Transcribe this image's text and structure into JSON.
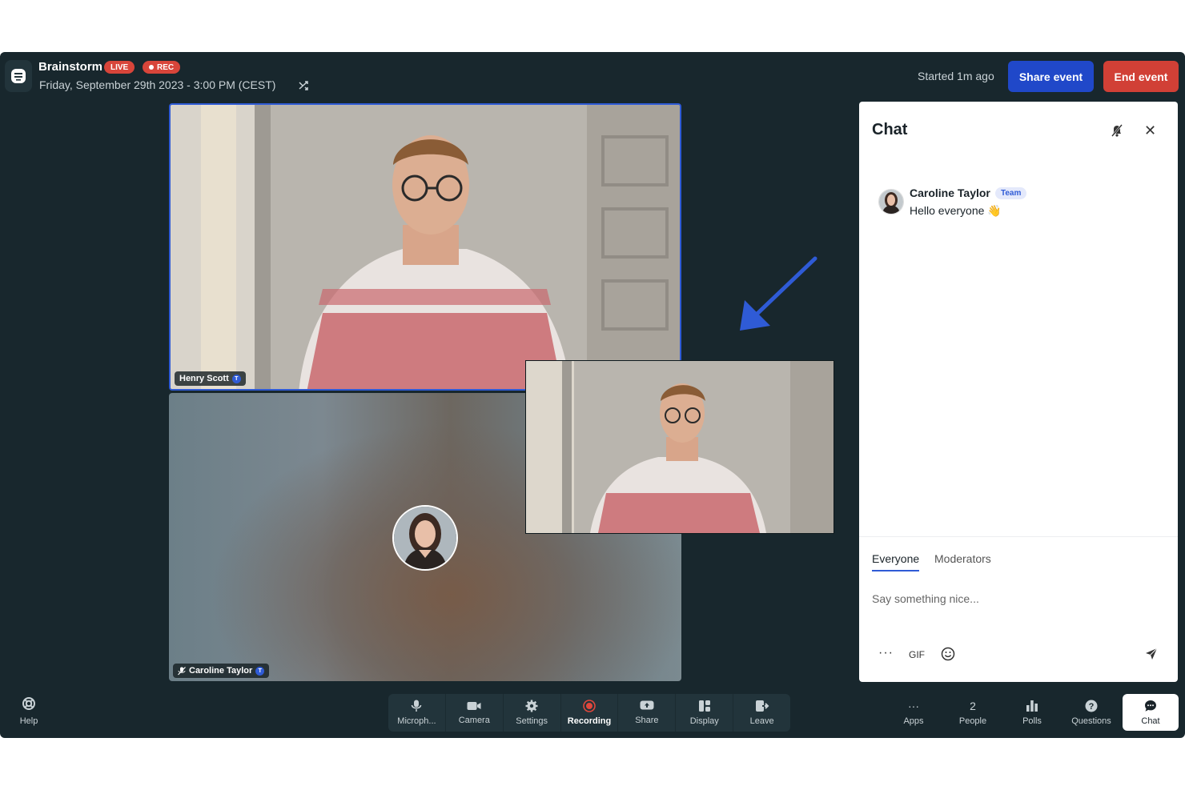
{
  "header": {
    "title": "Brainstorm",
    "live_badge": "LIVE",
    "rec_badge": "REC",
    "date": "Friday, September 29th 2023 - 3:00 PM (CEST)",
    "started": "Started 1m ago",
    "share_button": "Share event",
    "end_button": "End event"
  },
  "participants": {
    "henry": {
      "name": "Henry Scott",
      "badge": "T"
    },
    "caroline": {
      "name": "Caroline Taylor",
      "badge": "T"
    }
  },
  "chat": {
    "title": "Chat",
    "messages": [
      {
        "author": "Caroline Taylor",
        "role": "Team",
        "text": "Hello everyone 👋"
      }
    ],
    "tabs": [
      "Everyone",
      "Moderators"
    ],
    "input_placeholder": "Say something nice...",
    "gif_label": "GIF",
    "more_label": "···"
  },
  "controls": {
    "help": "Help",
    "main": [
      "Microph...",
      "Camera",
      "Settings",
      "Recording",
      "Share",
      "Display",
      "Leave"
    ],
    "right": {
      "apps": "Apps",
      "people_count": "2",
      "people": "People",
      "polls": "Polls",
      "questions": "Questions",
      "chat": "Chat"
    }
  },
  "colors": {
    "background": "#18272d",
    "accent_blue": "#2048c9",
    "danger_red": "#d14036",
    "badge_red": "#d8453a"
  }
}
